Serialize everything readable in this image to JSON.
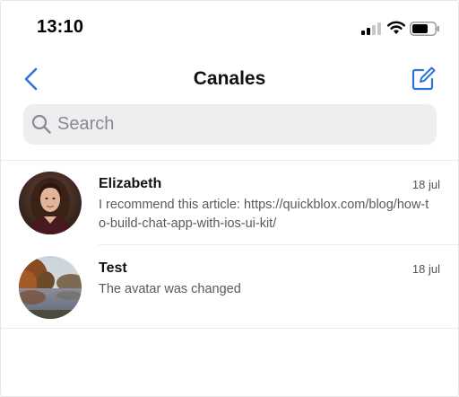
{
  "status_bar": {
    "time": "13:10",
    "icons": [
      "cellular-signal-icon",
      "wifi-icon",
      "battery-icon"
    ]
  },
  "nav": {
    "title": "Canales",
    "back_icon": "chevron-left-icon",
    "compose_icon": "compose-icon"
  },
  "search": {
    "placeholder": "Search",
    "value": ""
  },
  "chats": [
    {
      "name": "Elizabeth",
      "date": "18 jul",
      "preview": "I recommend this article: https://quickblox.com/blog/how-to-build-chat-app-with-ios-ui-kit/",
      "avatar": "woman-portrait-avatar"
    },
    {
      "name": "Test",
      "date": "18 jul",
      "preview": "The avatar was changed",
      "avatar": "autumn-landscape-avatar"
    }
  ],
  "colors": {
    "accent": "#2e73d9",
    "search_bg": "#eeeef0",
    "divider": "#ececec",
    "secondary_text": "#5a5a5a"
  }
}
